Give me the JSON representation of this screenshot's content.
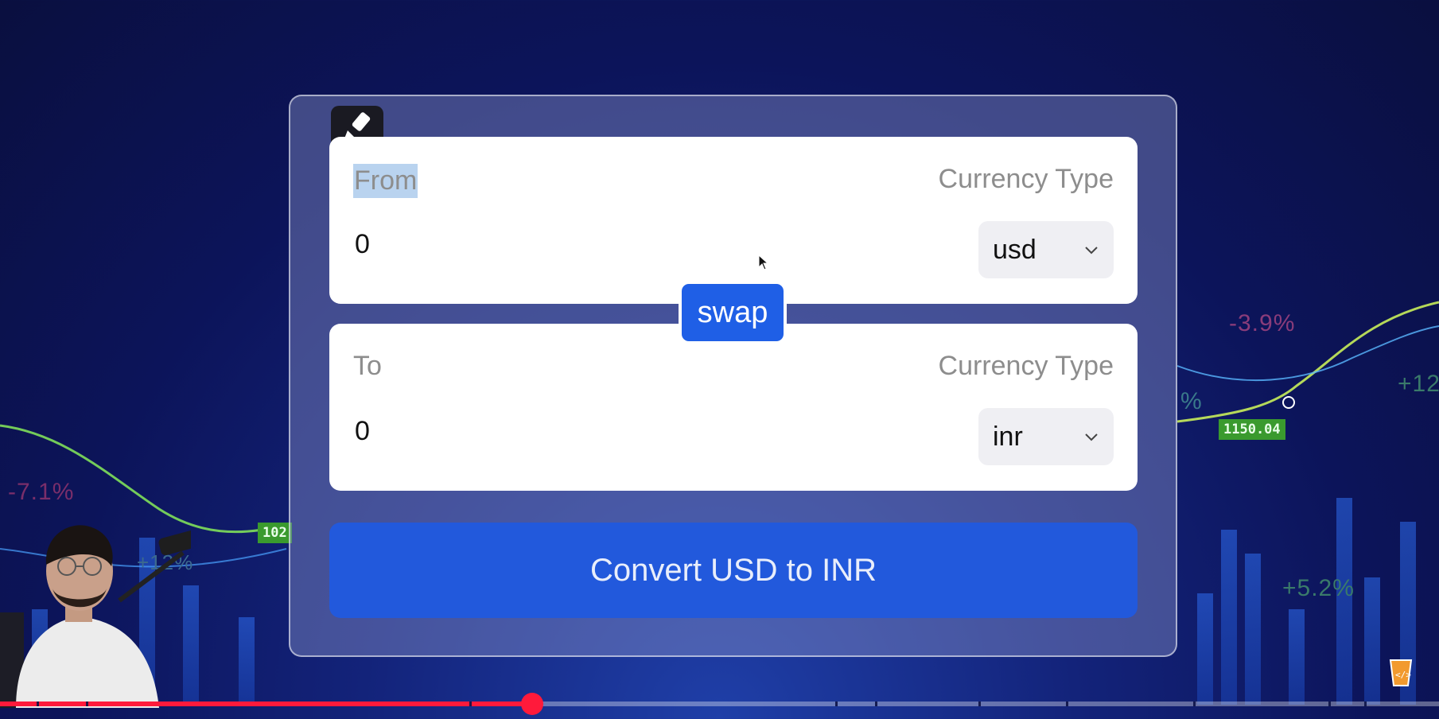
{
  "converter": {
    "from": {
      "label": "From",
      "currency_type_label": "Currency Type",
      "amount": "0",
      "currency": "usd"
    },
    "to": {
      "label": "To",
      "currency_type_label": "Currency Type",
      "amount": "0",
      "currency": "inr"
    },
    "swap_label": "swap",
    "convert_label": "Convert USD to INR",
    "tool_icon": "highlighter-icon"
  },
  "background": {
    "percent_labels": [
      "-7.1%",
      "+12%",
      "-3.9%",
      "+12",
      "+5.2%",
      "%"
    ],
    "price_tags": [
      "1150.04",
      "102"
    ]
  },
  "video": {
    "progress_fraction": 0.37
  },
  "colors": {
    "accent": "#1f5fe6",
    "convert_button": "#2259dc",
    "progress": "#ff1a3b",
    "highlight": "#b9d3ef"
  }
}
